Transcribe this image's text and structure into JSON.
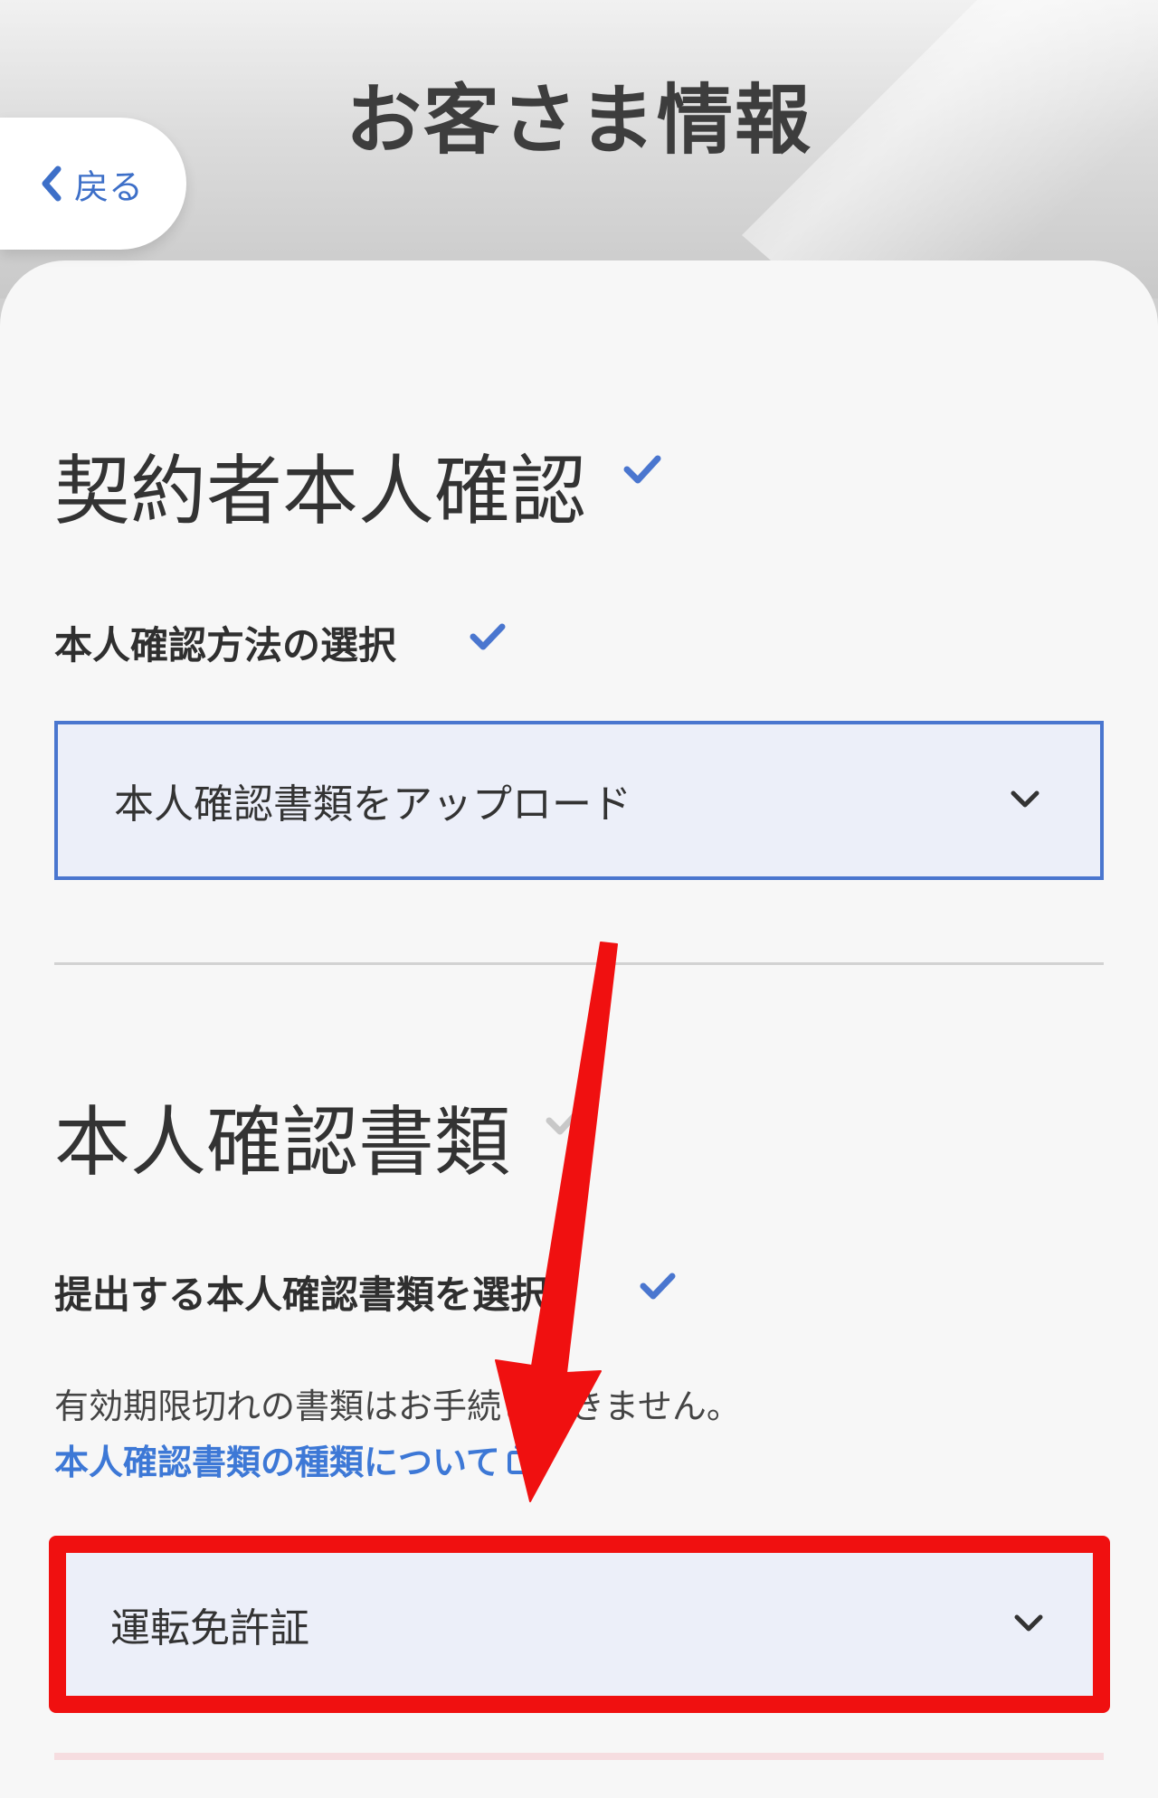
{
  "header": {
    "title": "お客さま情報",
    "back_label": "戻る"
  },
  "identity_section": {
    "title": "契約者本人確認",
    "method_label": "本人確認方法の選択",
    "method_value": "本人確認書類をアップロード"
  },
  "documents_section": {
    "title": "本人確認書類",
    "select_label": "提出する本人確認書類を選択",
    "note": "有効期限切れの書類はお手続きできません。",
    "link_label": "本人確認書類の種類について",
    "document_value": "運転免許証"
  },
  "colors": {
    "accent": "#4a76cf",
    "link": "#3d78d6",
    "annotation": "#f01010",
    "select_bg": "#eceff9"
  },
  "icons": [
    "chevron-left-icon",
    "checkmark-icon",
    "chevron-down-icon",
    "external-link-icon",
    "annotation-arrow"
  ]
}
